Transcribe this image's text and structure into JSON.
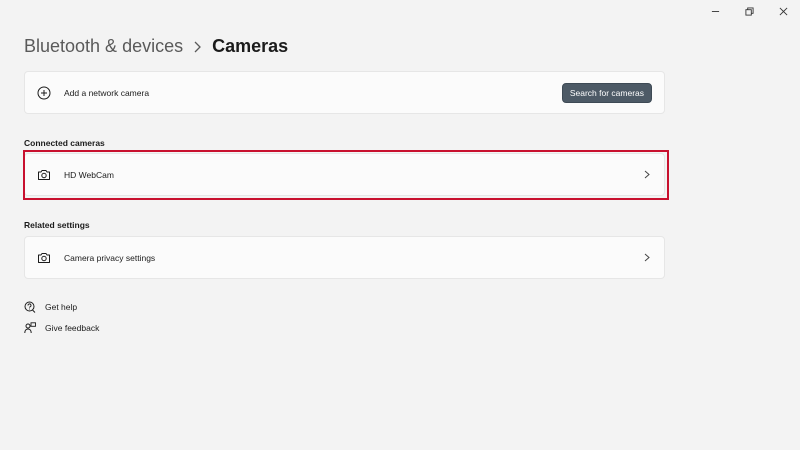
{
  "window_controls": {
    "minimize": "minimize-icon",
    "maximize": "restore-icon",
    "close": "close-icon"
  },
  "breadcrumb": {
    "parent": "Bluetooth & devices",
    "current": "Cameras"
  },
  "network_camera": {
    "label": "Add a network camera",
    "button_label": "Search for cameras",
    "icon": "add-circle-icon"
  },
  "connected_cameras": {
    "section_title": "Connected cameras",
    "items": [
      {
        "label": "HD WebCam",
        "icon": "camera-icon"
      }
    ]
  },
  "related_settings": {
    "section_title": "Related settings",
    "items": [
      {
        "label": "Camera privacy settings",
        "icon": "camera-icon"
      }
    ]
  },
  "help": {
    "get_help": "Get help",
    "give_feedback": "Give feedback"
  },
  "colors": {
    "background": "#f3f3f3",
    "card": "#fbfbfb",
    "accent_button": "#4d5a66",
    "highlight": "#c8102e"
  }
}
